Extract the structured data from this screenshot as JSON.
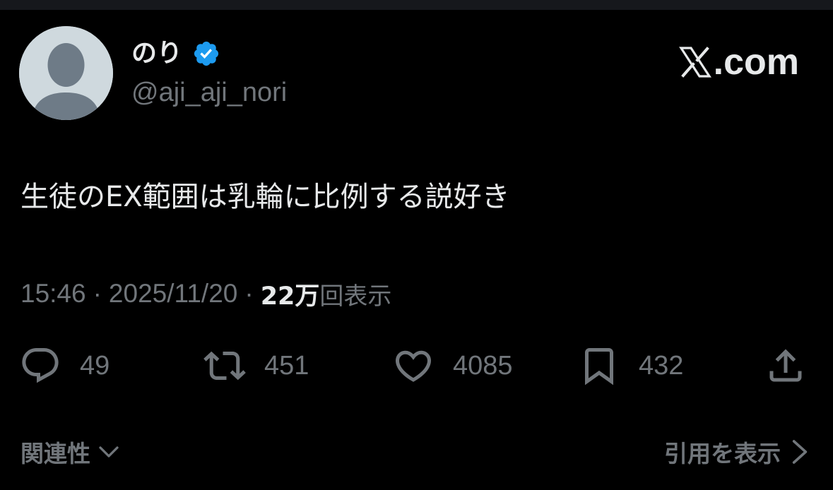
{
  "author": {
    "display_name": "のり",
    "handle": "@aji_aji_nori",
    "verified": true,
    "verified_color": "#1d9bf0"
  },
  "brand": {
    "text": ".com",
    "icon": "x-logo-icon"
  },
  "tweet": {
    "text": "生徒のEX範囲は乳輪に比例する説好き"
  },
  "meta": {
    "time": "15:46",
    "separator": "·",
    "date": "2025/11/20",
    "views_count": "22万",
    "views_label": "回表示"
  },
  "actions": {
    "replies": "49",
    "retweets": "451",
    "likes": "4085",
    "bookmarks": "432"
  },
  "footer": {
    "relevance_label": "関連性",
    "quotes_label": "引用を表示"
  },
  "colors": {
    "background": "#000000",
    "primary_text": "#e7e9ea",
    "secondary_text": "#71767b",
    "avatar_bg": "#cfd9de"
  }
}
